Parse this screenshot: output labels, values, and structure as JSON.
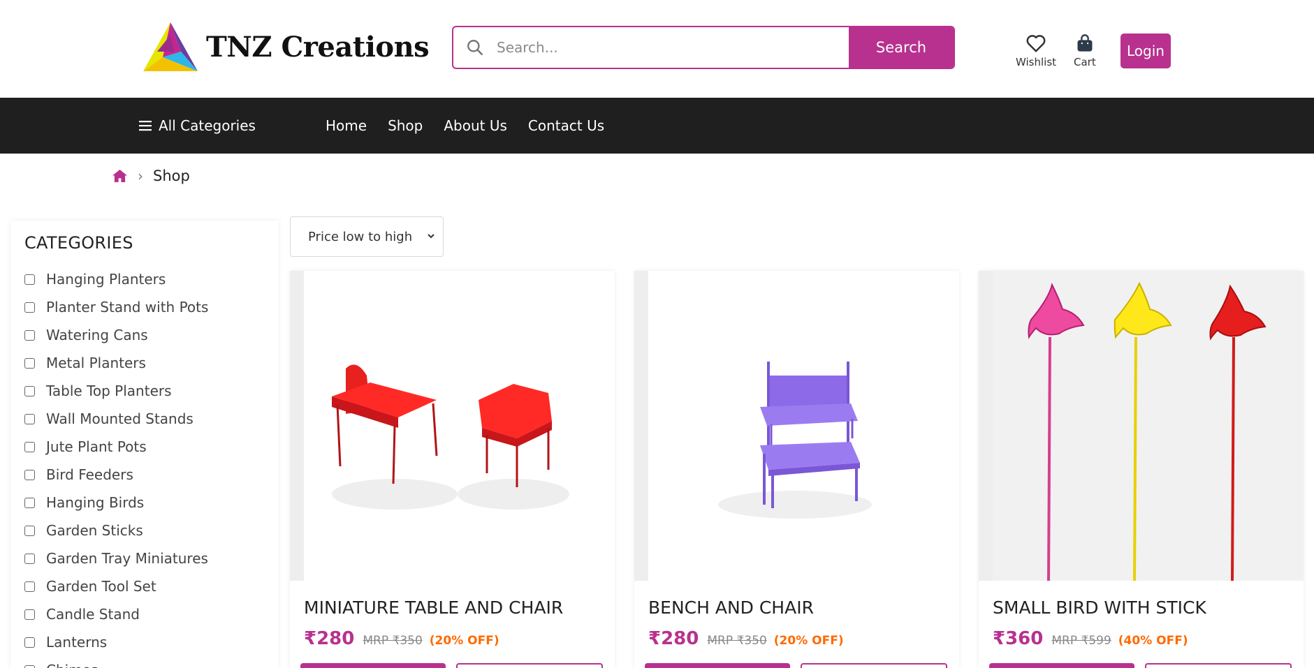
{
  "brand": {
    "name": "TNZ Creations",
    "accent": "#b8318e"
  },
  "search": {
    "placeholder": "Search...",
    "button_label": "Search"
  },
  "header": {
    "wishlist_label": "Wishlist",
    "cart_label": "Cart",
    "login_label": "Login"
  },
  "nav": {
    "all_categories": "All Categories",
    "links": [
      "Home",
      "Shop",
      "About Us",
      "Contact Us"
    ]
  },
  "breadcrumb": {
    "current": "Shop"
  },
  "sidebar": {
    "title": "CATEGORIES",
    "categories": [
      "Hanging Planters",
      "Planter Stand with Pots",
      "Watering Cans",
      "Metal Planters",
      "Table Top Planters",
      "Wall Mounted Stands",
      "Jute Plant Pots",
      "Bird Feeders",
      "Hanging Birds",
      "Garden Sticks",
      "Garden Tray Miniatures",
      "Garden Tool Set",
      "Candle Stand",
      "Lanterns",
      "Chimes"
    ]
  },
  "sort": {
    "selected": "Price low to high"
  },
  "products": [
    {
      "title": "MINIATURE TABLE AND CHAIR",
      "price": "₹280",
      "mrp": "MRP ₹350",
      "discount": "(20% OFF)"
    },
    {
      "title": "BENCH AND CHAIR",
      "price": "₹280",
      "mrp": "MRP ₹350",
      "discount": "(20% OFF)"
    },
    {
      "title": "SMALL BIRD WITH STICK",
      "price": "₹360",
      "mrp": "MRP ₹599",
      "discount": "(40% OFF)"
    }
  ]
}
